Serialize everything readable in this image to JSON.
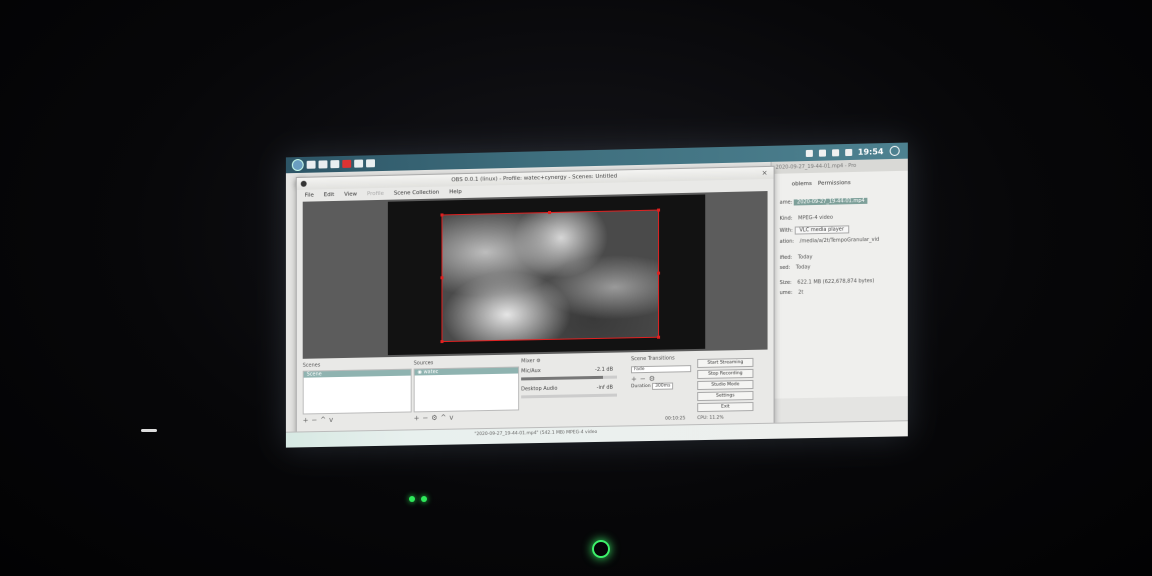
{
  "panel": {
    "clock": "19:54"
  },
  "props_dialog": {
    "title": "2020-09-27_19-44-01.mp4 - Pro",
    "tabs": [
      "oblems",
      "Permissions"
    ],
    "name_label": "ame:",
    "name_value": "2020-09-27_19-44-01.mp4",
    "kind_label": "Kind:",
    "kind_value": "MPEG-4 video",
    "open_with_label": "With:",
    "open_with_value": "VLC media player",
    "location_label": "ation:",
    "location_value": "/media/a/2t/TempoGranular_vid",
    "modified_label": "ified:",
    "modified_value": "Today",
    "accessed_label": "sed:",
    "accessed_value": "Today",
    "size_label": "Size:",
    "size_value": "622.1 MB (622,678,874 bytes)",
    "volume_label": "ume:",
    "volume_value": "2t"
  },
  "obs": {
    "title": "OBS 0.0.1 (linux) - Profile: watec+cynergy - Scenes: Untitled",
    "menu": [
      "File",
      "Edit",
      "View",
      "Profile",
      "Scene Collection",
      "Help"
    ],
    "scenes": {
      "title": "Scenes",
      "items": [
        "Scene"
      ]
    },
    "sources": {
      "title": "Sources",
      "items": [
        "watec"
      ]
    },
    "mixer": {
      "title": "Mixer",
      "channels": [
        {
          "name": "Mic/Aux",
          "db": "-2.1 dB",
          "level": 0.85
        },
        {
          "name": "Desktop Audio",
          "db": "-inf dB",
          "level": 0.0
        }
      ]
    },
    "transitions": {
      "title": "Scene Transitions",
      "selected": "Fade",
      "duration_label": "Duration",
      "duration_value": "300ms"
    },
    "controls": [
      "Start Streaming",
      "Stop Recording",
      "Studio Mode",
      "Settings",
      "Exit"
    ],
    "status": {
      "rec_time": "00:10:25",
      "cpu": "CPU: 11.2%"
    }
  },
  "taskbar": {
    "status_text": "\"2020-09-27_19-44-01.mp4\" (542.1 MB) MPEG-4 video"
  },
  "colors": {
    "panel": "#3e6e7d",
    "selection_border": "#e02020",
    "led_green": "#2ee85a"
  }
}
